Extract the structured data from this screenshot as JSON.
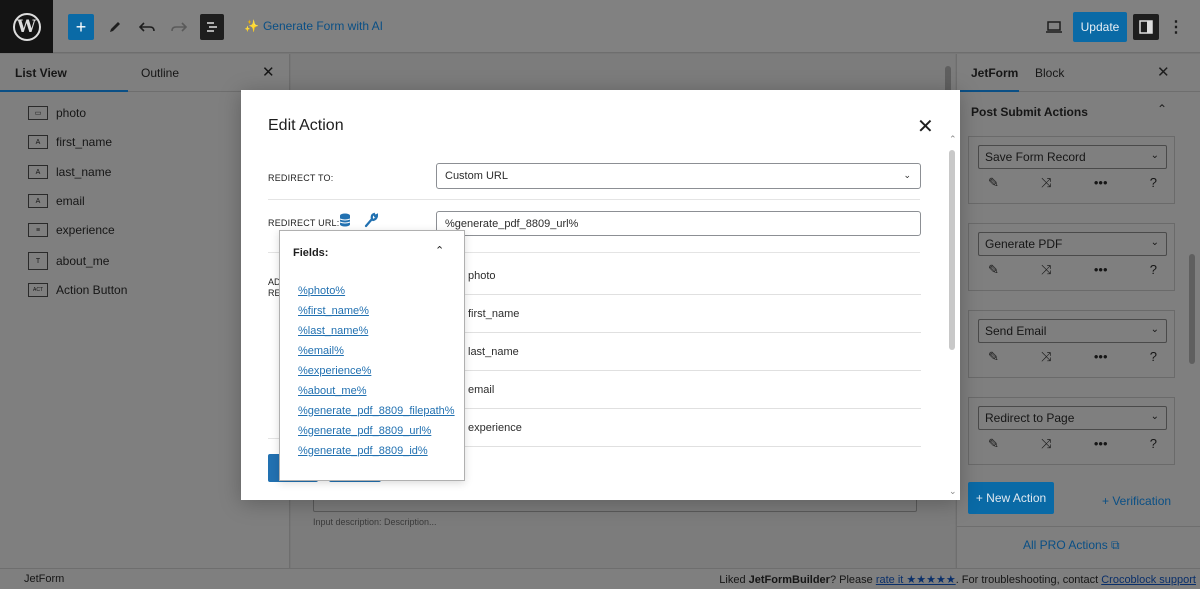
{
  "toolbar": {
    "ai_label": "Generate Form with AI",
    "update_label": "Update"
  },
  "list_view": {
    "tab_list": "List View",
    "tab_outline": "Outline",
    "items": [
      {
        "label": "photo",
        "icon": "image-field-icon"
      },
      {
        "label": "first_name",
        "icon": "text-field-icon"
      },
      {
        "label": "last_name",
        "icon": "text-field-icon"
      },
      {
        "label": "email",
        "icon": "text-field-icon"
      },
      {
        "label": "experience",
        "icon": "select-field-icon"
      },
      {
        "label": "about_me",
        "icon": "textarea-field-icon"
      },
      {
        "label": "Action Button",
        "icon": "action-button-icon"
      }
    ]
  },
  "canvas": {
    "input_description": "Input description:  Description..."
  },
  "right_panel": {
    "tab_jetform": "JetForm",
    "tab_block": "Block",
    "section_title": "Post Submit Actions",
    "actions": [
      {
        "label": "Save Form Record"
      },
      {
        "label": "Generate PDF"
      },
      {
        "label": "Send Email"
      },
      {
        "label": "Redirect to Page"
      }
    ],
    "new_action_label": "+ New Action",
    "verification_label": "+ Verification",
    "pro_actions_label": "All PRO Actions"
  },
  "footer": {
    "left": "JetForm",
    "right_prefix": "Liked ",
    "right_brand": "JetFormBuilder",
    "right_mid": "? Please ",
    "right_rate": "rate it ★★★★★",
    "right_suffix": ". For troubleshooting, contact ",
    "right_link": "Crocoblock support"
  },
  "modal": {
    "title": "Edit Action",
    "redirect_to_label": "REDIRECT TO:",
    "redirect_to_value": "Custom URL",
    "redirect_url_label": "REDIRECT URL:",
    "redirect_url_value": "%generate_pdf_8809_url%",
    "add_label_partial_1": "AD",
    "add_label_partial_2": "RE",
    "field_rows": [
      "photo",
      "first_name",
      "last_name",
      "email",
      "experience"
    ]
  },
  "fields_popover": {
    "title": "Fields:",
    "links": [
      "%photo%",
      "%first_name%",
      "%last_name%",
      "%email%",
      "%experience%",
      "%about_me%",
      "%generate_pdf_8809_filepath%",
      "%generate_pdf_8809_url%",
      "%generate_pdf_8809_id%"
    ]
  }
}
